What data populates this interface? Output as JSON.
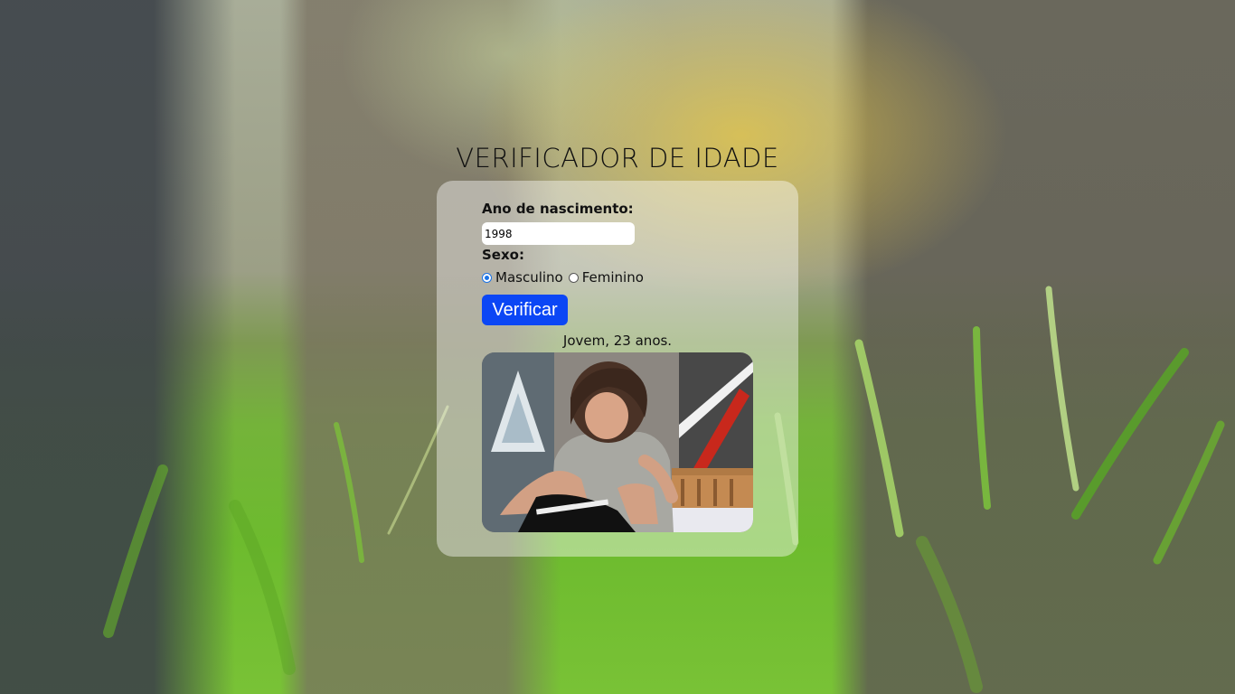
{
  "page": {
    "title": "VERIFICADOR DE IDADE"
  },
  "form": {
    "year_label": "Ano de nascimento:",
    "year_value": "1998",
    "sex_label": "Sexo:",
    "options": [
      {
        "label": "Masculino",
        "checked": true
      },
      {
        "label": "Feminino",
        "checked": false
      }
    ],
    "verify_label": "Verificar"
  },
  "result": {
    "text": "Jovem, 23 anos.",
    "image": "young-man-playing-guitar"
  },
  "colors": {
    "button": "#0b46f5",
    "radio_accent": "#1a73e8",
    "card_background": "rgba(255,255,255,0.42)"
  }
}
